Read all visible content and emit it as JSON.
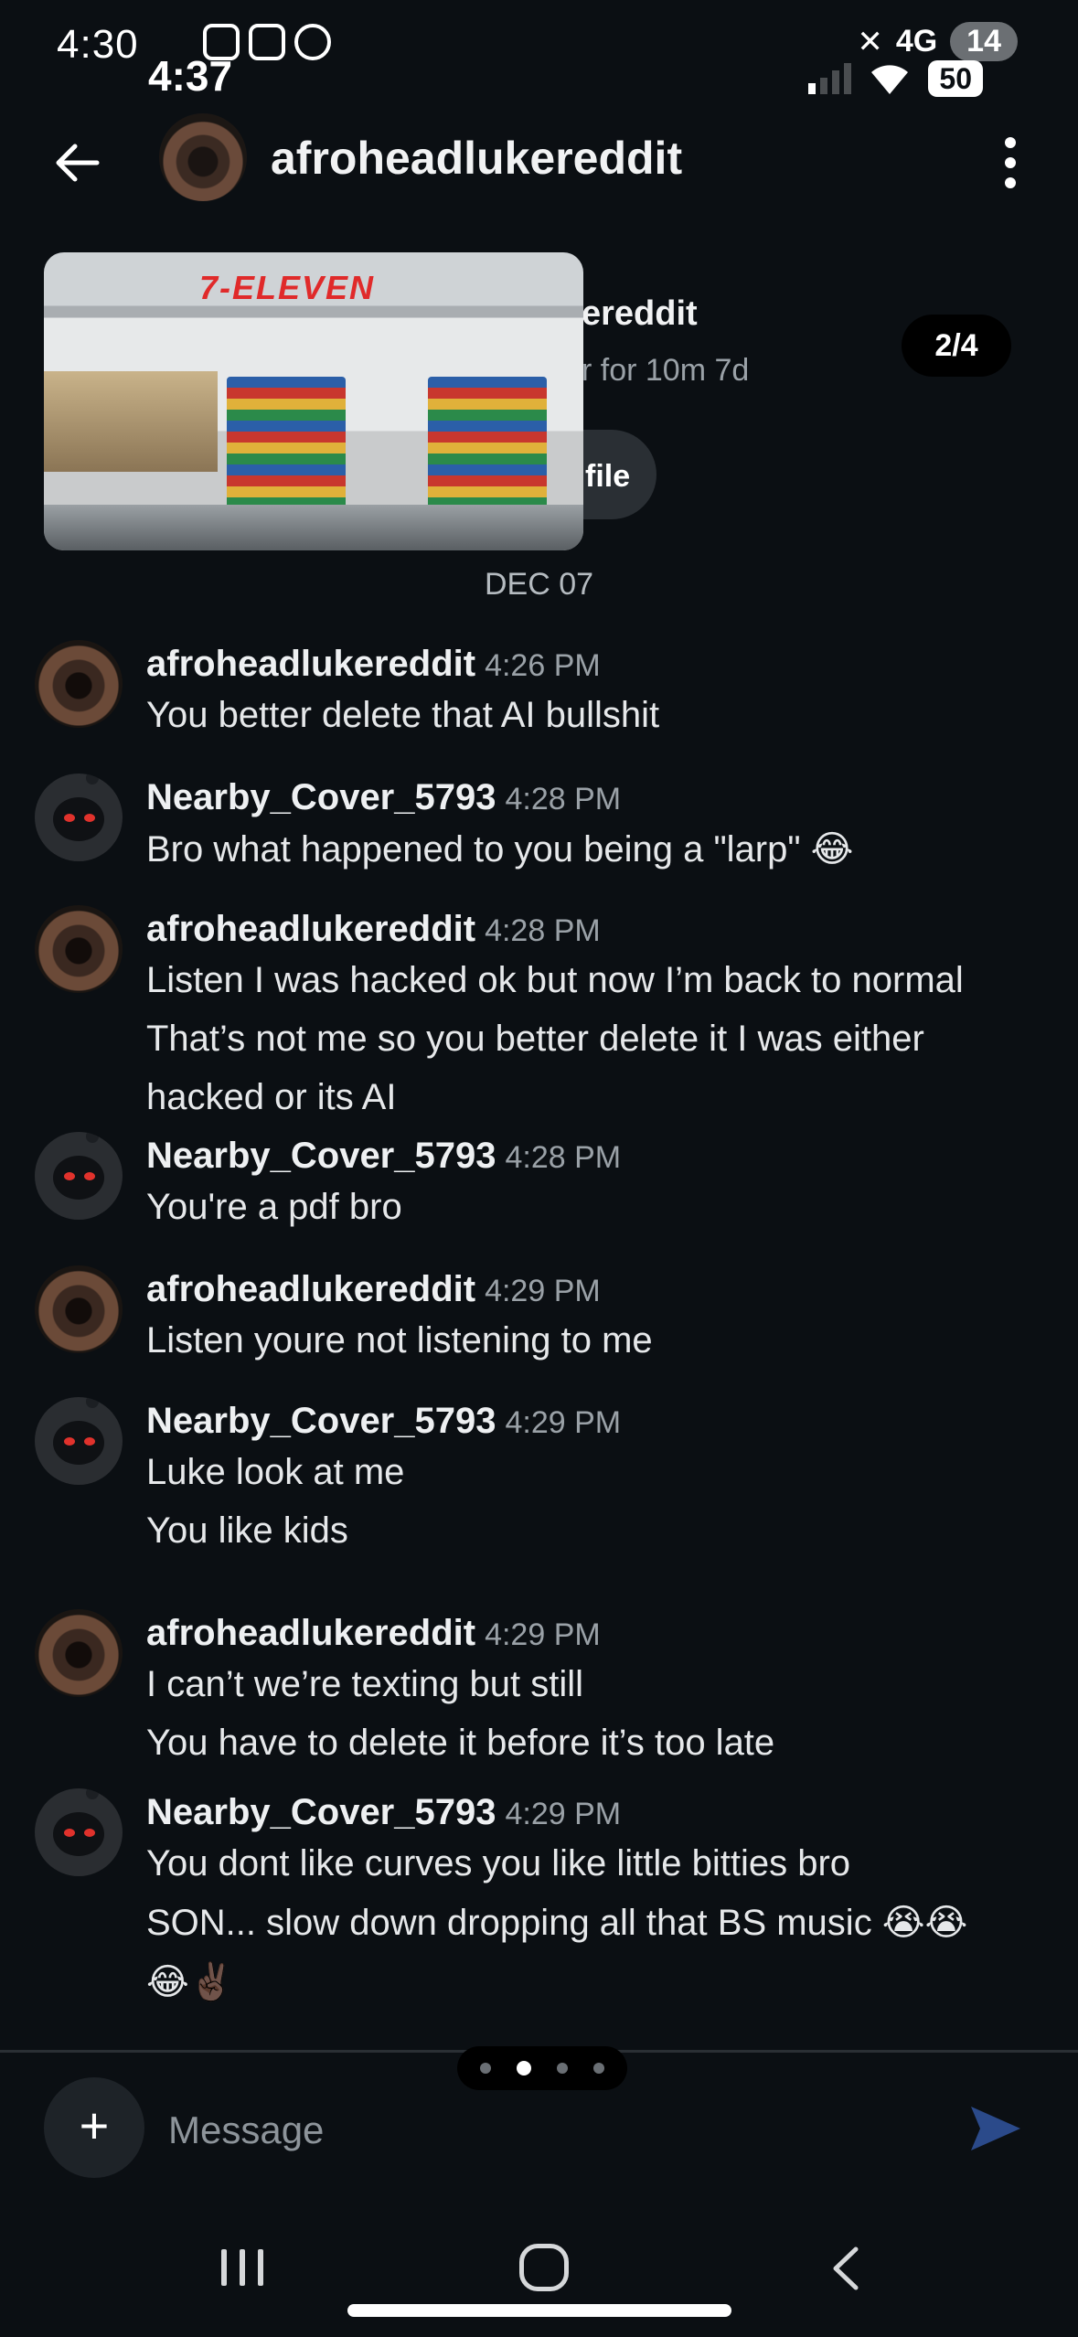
{
  "status_outer": {
    "time": "4:30",
    "network": "4G",
    "battery": "14"
  },
  "status_inner": {
    "time": "4:37",
    "battery": "50"
  },
  "header": {
    "title": "afroheadlukereddit"
  },
  "preview": {
    "store_sign": "7-ELEVEN",
    "text": "ereddit",
    "sub": "r for 10m 7d",
    "profile_btn": "file",
    "page_indicator": "2/4"
  },
  "date_divider": "DEC 07",
  "messages": [
    {
      "user": "afroheadlukereddit",
      "time": "4:26 PM",
      "avatar": "afro",
      "lines": [
        "You better delete that AI bullshit"
      ]
    },
    {
      "user": "Nearby_Cover_5793",
      "time": "4:28 PM",
      "avatar": "snoo",
      "lines": [
        "Bro what happened to you being a \"larp\" 😂"
      ]
    },
    {
      "user": "afroheadlukereddit",
      "time": "4:28 PM",
      "avatar": "afro",
      "lines": [
        "Listen I was hacked ok but now I’m back to normal",
        "That’s not me so you better delete it I was either",
        "hacked or its AI"
      ]
    },
    {
      "user": "Nearby_Cover_5793",
      "time": "4:28 PM",
      "avatar": "snoo",
      "lines": [
        "You're a pdf bro"
      ]
    },
    {
      "user": "afroheadlukereddit",
      "time": "4:29 PM",
      "avatar": "afro",
      "lines": [
        "Listen youre not listening to me"
      ]
    },
    {
      "user": "Nearby_Cover_5793",
      "time": "4:29 PM",
      "avatar": "snoo",
      "lines": [
        "Luke look at me",
        "You like kids"
      ]
    },
    {
      "user": "afroheadlukereddit",
      "time": "4:29 PM",
      "avatar": "afro",
      "lines": [
        "I can’t we’re texting but still",
        "You have to delete it before it’s too late"
      ]
    },
    {
      "user": "Nearby_Cover_5793",
      "time": "4:29 PM",
      "avatar": "snoo",
      "lines": [
        "You dont like curves you like little bitties bro",
        "SON... slow down dropping all that BS music 😭😭",
        "😂✌🏿"
      ]
    }
  ],
  "composer": {
    "add_label": "+",
    "placeholder": "Message"
  },
  "colors": {
    "background": "#0b0f13",
    "send_icon": "#2b4a8a",
    "snoo_eye": "#e0322c"
  }
}
